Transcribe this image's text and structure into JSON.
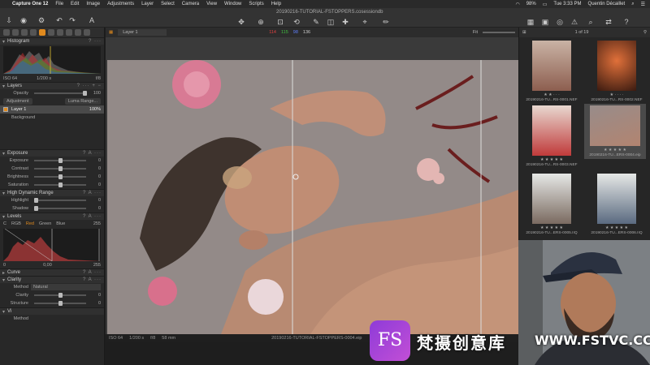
{
  "menubar": {
    "app": "Capture One 12",
    "items": [
      "File",
      "Edit",
      "Image",
      "Adjustments",
      "Layer",
      "Select",
      "Camera",
      "View",
      "Window",
      "Scripts",
      "Help"
    ],
    "battery": "98%",
    "day_time": "Tue 3:33 PM",
    "user": "Quentin Décaillet"
  },
  "toolbar": {
    "session": "20190216-TUTORIAL-FSTOPPERS.cosessiondb"
  },
  "viewer": {
    "layer_select": "Layer 1",
    "rgb_readout": {
      "r": "114",
      "g": "115",
      "b": "98",
      "l": "136"
    },
    "fit": "Fit"
  },
  "histogram": {
    "title": "Histogram",
    "iso": "ISO 64",
    "shutter": "1/200 s",
    "aperture": "f/8"
  },
  "layers": {
    "title": "Layers",
    "opacity_label": "Opacity",
    "opacity_value": "100",
    "adjustment_btn": "Adjustment",
    "luma_btn": "Luma Range...",
    "items": [
      {
        "name": "Layer 1",
        "value": "100%"
      },
      {
        "name": "Background",
        "value": ""
      }
    ]
  },
  "exposure": {
    "title": "Exposure",
    "rows": [
      {
        "label": "Exposure",
        "value": "0"
      },
      {
        "label": "Contrast",
        "value": "0"
      },
      {
        "label": "Brightness",
        "value": "0"
      },
      {
        "label": "Saturation",
        "value": "0"
      }
    ]
  },
  "hdr": {
    "title": "High Dynamic Range",
    "rows": [
      {
        "label": "Highlight",
        "value": "0"
      },
      {
        "label": "Shadow",
        "value": "0"
      }
    ]
  },
  "levels": {
    "title": "Levels",
    "channels": [
      "C",
      "RGB",
      "Red",
      "Green",
      "Blue"
    ],
    "left": "0",
    "mid": "0,00",
    "right": "255",
    "top_right": "255"
  },
  "curve": {
    "title": "Curve"
  },
  "clarity": {
    "title": "Clarity",
    "method_label": "Method",
    "method_value": "Natural",
    "rows": [
      {
        "label": "Clarity",
        "value": "0"
      },
      {
        "label": "Structure",
        "value": "0"
      }
    ]
  },
  "vignetting": {
    "title": "Vi",
    "method_label": "Method"
  },
  "status": {
    "iso": "ISO 64",
    "shutter": "1/200 s",
    "aperture": "f/8",
    "focal": "58 mm",
    "filename": "20190216-TUTORIAL-FSTOPPERS-0004.eip"
  },
  "browser": {
    "count": "1 of 19",
    "thumbs": [
      {
        "name": "20190216-TU...RS-0001.NEF",
        "stars": "★ ★ · · ·"
      },
      {
        "name": "20190216-TU...RS-0002.NEF",
        "stars": "★ · · · ·"
      },
      {
        "name": "20190216-TU...RS-0003.NEF",
        "stars": "★ ★ ★ ★ ★"
      },
      {
        "name": "20190216-TU...ERS-0004.eip",
        "stars": "★ ★ ★ ★ ★"
      },
      {
        "name": "20190216-TU...ERS-0005.IIQ",
        "stars": "★ ★ ★ ★ ★"
      },
      {
        "name": "20190216-TU...ERS-0006.IIQ",
        "stars": "★ ★ ★ ★ ★"
      }
    ]
  },
  "watermark": {
    "badge": "FS",
    "cn": "梵摄创意库",
    "url": "WWW.FSTVC.CC"
  }
}
